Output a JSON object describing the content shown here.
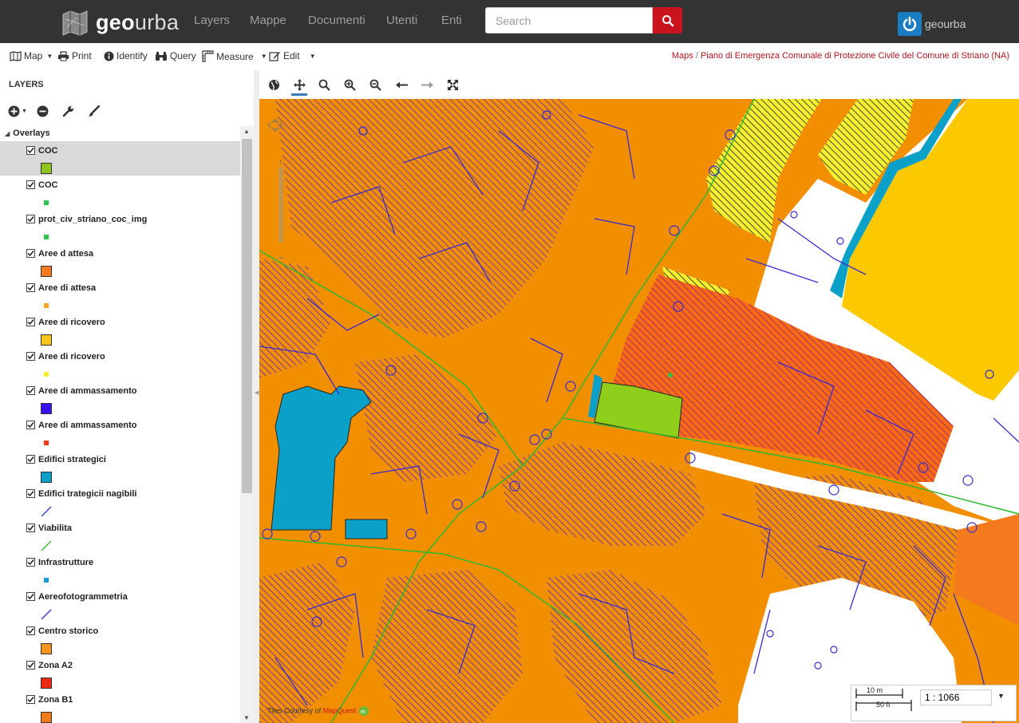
{
  "brand": {
    "name_bold": "geo",
    "name_light": "urba"
  },
  "nav": {
    "links": [
      "Layers",
      "Mappe",
      "Documenti",
      "Utenti",
      "Enti"
    ],
    "search_placeholder": "Search",
    "user_name": "geourba"
  },
  "toolbar": {
    "map": "Map",
    "print": "Print",
    "identify": "Identify",
    "query": "Query",
    "measure": "Measure",
    "edit": "Edit",
    "breadcrumb_root": "Maps",
    "breadcrumb_sep": "/",
    "breadcrumb_current": "Piano di Emergenza Comunale di Protezione Civile del Comune di Striano (NA)"
  },
  "panel": {
    "title": "LAYERS",
    "group": "Overlays",
    "layers": [
      {
        "label": "COC",
        "checked": true,
        "legend": "square",
        "color": "#8fc31f",
        "selected": true
      },
      {
        "label": "COC",
        "checked": true,
        "legend": "dot",
        "color": "#2ec24c"
      },
      {
        "label": "prot_civ_striano_coc_img",
        "checked": true,
        "legend": "dot",
        "color": "#2ec24c"
      },
      {
        "label": "Aree d attesa",
        "checked": true,
        "legend": "square",
        "color": "#f57a1e"
      },
      {
        "label": "Aree di attesa",
        "checked": true,
        "legend": "dot",
        "color": "#f5a623"
      },
      {
        "label": "Aree di ricovero",
        "checked": true,
        "legend": "square",
        "color": "#f7c51e"
      },
      {
        "label": "Aree di ricovero",
        "checked": true,
        "legend": "dot",
        "color": "#f6f02a"
      },
      {
        "label": "Aree di ammassamento",
        "checked": true,
        "legend": "square",
        "color": "#3a10f0"
      },
      {
        "label": "Aree di ammassamento",
        "checked": true,
        "legend": "dot",
        "color": "#ee3a1c"
      },
      {
        "label": "Edifici strategici",
        "checked": true,
        "legend": "square",
        "color": "#0aa0c8"
      },
      {
        "label": "Edifici trategicii nagibili",
        "checked": true,
        "legend": "line",
        "color": "#3040c0"
      },
      {
        "label": "Viabilita",
        "checked": true,
        "legend": "line",
        "color": "#2eb82e"
      },
      {
        "label": "Infrastrutture",
        "checked": true,
        "legend": "dot",
        "color": "#14a0d8"
      },
      {
        "label": "Aereofotogrammetria",
        "checked": true,
        "legend": "line",
        "color": "#3a2ad0"
      },
      {
        "label": "Centro storico",
        "checked": true,
        "legend": "square",
        "color": "#f5941e"
      },
      {
        "label": "Zona A2",
        "checked": true,
        "legend": "square",
        "color": "#ec2a14"
      },
      {
        "label": "Zona B1",
        "checked": true,
        "legend": "square",
        "color": "#f07a1a"
      }
    ]
  },
  "map": {
    "attribution_prefix": "Tiles Courtesy of",
    "attribution_link": "MapQuest",
    "scale_m": "10 m",
    "scale_ft": "50 ft",
    "scale_value": "1 : 1066"
  }
}
